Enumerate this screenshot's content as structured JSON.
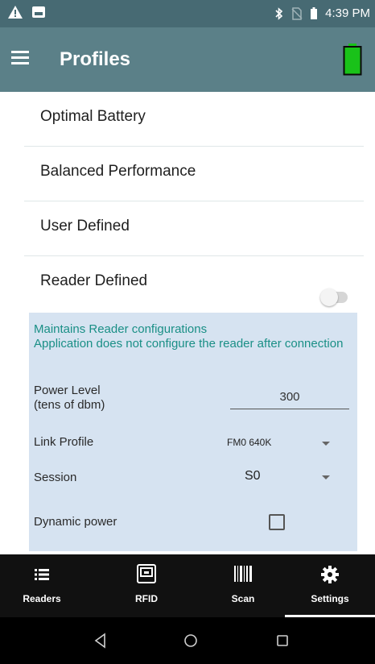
{
  "status_bar": {
    "time": "4:39 PM",
    "icons": [
      "warning-icon",
      "image-icon",
      "bluetooth-icon",
      "no-sim-icon",
      "battery-icon"
    ]
  },
  "app_bar": {
    "title": "Profiles",
    "menu_icon": "menu-icon",
    "battery_icon": "battery-full-icon",
    "battery_color": "#19c219"
  },
  "profiles": [
    {
      "label": "Optimal Battery"
    },
    {
      "label": "Balanced Performance"
    },
    {
      "label": "User Defined"
    },
    {
      "label": "Reader Defined",
      "toggle_on": false
    }
  ],
  "panel": {
    "description_line1": "Maintains Reader configurations",
    "description_line2": "Application does not configure the reader after connection",
    "power_label_line1": "Power Level",
    "power_label_line2": "(tens of dbm)",
    "power_value": "300",
    "link_profile_label": "Link Profile",
    "link_profile_value": "FM0 640K",
    "session_label": "Session",
    "session_value": "S0",
    "dynamic_power_label": "Dynamic power",
    "dynamic_power_checked": false,
    "background": "#d6e3f1",
    "accent": "#1a8f86"
  },
  "bottom_nav": {
    "items": [
      {
        "label": "Readers",
        "icon": "list-icon"
      },
      {
        "label": "RFID",
        "icon": "rfid-icon"
      },
      {
        "label": "Scan",
        "icon": "barcode-icon"
      },
      {
        "label": "Settings",
        "icon": "gear-icon",
        "selected": true
      }
    ]
  },
  "system_nav": {
    "icons": [
      "back-icon",
      "home-icon",
      "recents-icon"
    ]
  }
}
